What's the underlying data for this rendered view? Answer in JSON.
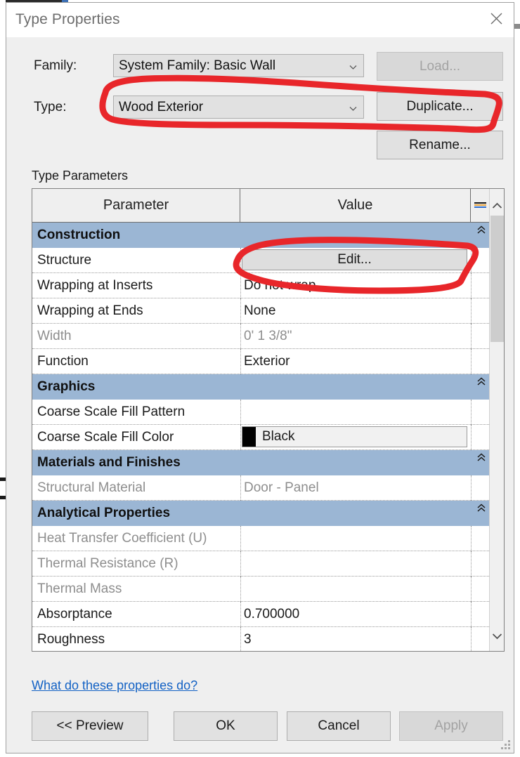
{
  "window": {
    "title": "Type Properties",
    "close_icon": "close-icon"
  },
  "form": {
    "family_label": "Family:",
    "family_value": "System Family: Basic Wall",
    "type_label": "Type:",
    "type_value": "Wood Exterior",
    "load_button": "Load...",
    "duplicate_button": "Duplicate...",
    "rename_button": "Rename...",
    "dropdown_icon": "chevron-down-icon"
  },
  "parameters": {
    "caption": "Type Parameters",
    "columns": {
      "parameter": "Parameter",
      "value": "Value",
      "equals": "=",
      "equals_icon": "equals-lock-icon"
    },
    "collapse_icon": "double-chevron-up-icon",
    "rows": [
      {
        "kind": "section",
        "label": "Construction"
      },
      {
        "kind": "data",
        "parameter": "Structure",
        "value": "Edit...",
        "control": "button",
        "dim": false
      },
      {
        "kind": "data",
        "parameter": "Wrapping at Inserts",
        "value": "Do not wrap",
        "control": "text",
        "dim": false
      },
      {
        "kind": "data",
        "parameter": "Wrapping at Ends",
        "value": "None",
        "control": "text",
        "dim": false
      },
      {
        "kind": "data",
        "parameter": "Width",
        "value": "0'  1 3/8\"",
        "control": "text",
        "dim": true
      },
      {
        "kind": "data",
        "parameter": "Function",
        "value": "Exterior",
        "control": "text",
        "dim": false
      },
      {
        "kind": "section",
        "label": "Graphics"
      },
      {
        "kind": "data",
        "parameter": "Coarse Scale Fill Pattern",
        "value": "",
        "control": "text",
        "dim": false
      },
      {
        "kind": "data",
        "parameter": "Coarse Scale Fill Color",
        "value": "Black",
        "control": "color",
        "swatch": "#000000",
        "dim": false
      },
      {
        "kind": "section",
        "label": "Materials and Finishes"
      },
      {
        "kind": "data",
        "parameter": "Structural Material",
        "value": "Door - Panel",
        "control": "text",
        "dim": true
      },
      {
        "kind": "section",
        "label": "Analytical Properties"
      },
      {
        "kind": "data",
        "parameter": "Heat Transfer Coefficient (U)",
        "value": "",
        "control": "text",
        "dim": true
      },
      {
        "kind": "data",
        "parameter": "Thermal Resistance (R)",
        "value": "",
        "control": "text",
        "dim": true
      },
      {
        "kind": "data",
        "parameter": "Thermal Mass",
        "value": "",
        "control": "text",
        "dim": true
      },
      {
        "kind": "data",
        "parameter": "Absorptance",
        "value": "0.700000",
        "control": "text",
        "dim": false
      },
      {
        "kind": "data",
        "parameter": "Roughness",
        "value": "3",
        "control": "text",
        "dim": false
      }
    ],
    "scrollbar": {
      "up_icon": "chevron-up-icon",
      "down_icon": "chevron-down-icon"
    }
  },
  "footer": {
    "help_link": "What do these properties do?",
    "preview_button": "<< Preview",
    "ok_button": "OK",
    "cancel_button": "Cancel",
    "apply_button": "Apply"
  },
  "annotations": {
    "color": "#e8262a",
    "marks": [
      {
        "name": "type-row-highlight-ellipse",
        "target": "Type dropdown and Duplicate button"
      },
      {
        "name": "structure-edit-highlight-ellipse",
        "target": "Structure Edit... button"
      }
    ]
  }
}
